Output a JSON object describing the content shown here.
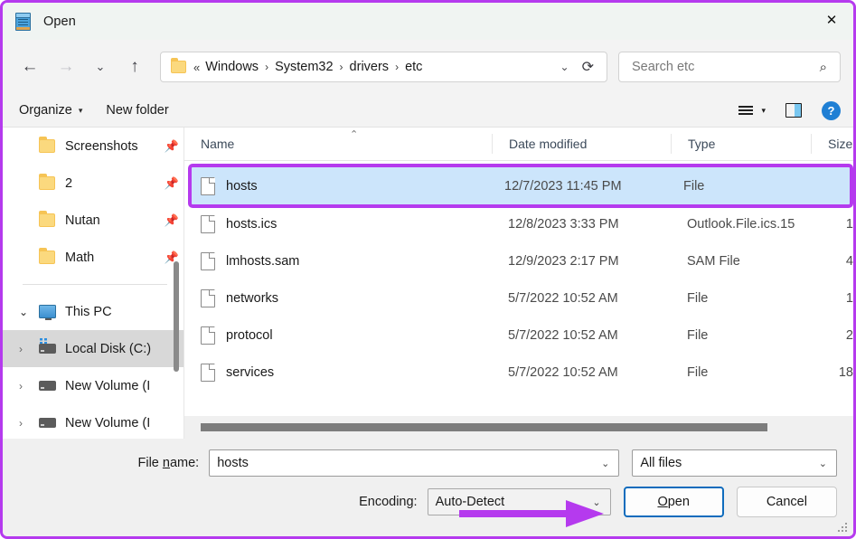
{
  "window": {
    "title": "Open",
    "icon": "notepad-icon",
    "close_label": "✕",
    "accent_annotation_color": "#b53aee",
    "focus_color": "#0f6cbd",
    "selection_color": "#cce5fb"
  },
  "nav": {
    "back": "←",
    "forward": "→",
    "recent": "⌄",
    "up": "↑",
    "breadcrumb": {
      "leading": "«",
      "items": [
        "Windows",
        "System32",
        "drivers",
        "etc"
      ],
      "separator": "›",
      "dropdown_caret": "⌄",
      "refresh": "⟳"
    },
    "search": {
      "placeholder": "Search etc",
      "icon": "⌕"
    }
  },
  "commandbar": {
    "organize": "Organize",
    "organize_caret": "▾",
    "new_folder": "New folder",
    "view_caret": "▾",
    "help": "?"
  },
  "sidebar": {
    "items": [
      {
        "label": "Screenshots",
        "icon": "folder-icon",
        "pin": "📌",
        "chevron": "",
        "selected": false,
        "type": "folder"
      },
      {
        "label": "2",
        "icon": "folder-icon",
        "pin": "📌",
        "chevron": "",
        "selected": false,
        "type": "folder"
      },
      {
        "label": "Nutan",
        "icon": "folder-icon",
        "pin": "📌",
        "chevron": "",
        "selected": false,
        "type": "folder"
      },
      {
        "label": "Math",
        "icon": "folder-icon",
        "pin": "📌",
        "chevron": "",
        "selected": false,
        "type": "folder"
      }
    ],
    "tree": [
      {
        "label": "This PC",
        "icon": "this-pc-icon",
        "chevron": "⌄",
        "selected": false,
        "type": "pc"
      },
      {
        "label": "Local Disk (C:)",
        "icon": "system-drive-icon",
        "chevron": "›",
        "selected": true,
        "type": "drive-sys"
      },
      {
        "label": "New Volume (I",
        "icon": "drive-icon",
        "chevron": "›",
        "selected": false,
        "type": "drive"
      },
      {
        "label": "New Volume (I",
        "icon": "drive-icon",
        "chevron": "›",
        "selected": false,
        "type": "drive"
      }
    ]
  },
  "filelist": {
    "sort_caret": "⌃",
    "columns": [
      "Name",
      "Date modified",
      "Type",
      "Size"
    ],
    "rows": [
      {
        "name": "hosts",
        "date": "12/7/2023 11:45 PM",
        "type": "File",
        "size": "",
        "selected": true
      },
      {
        "name": "hosts.ics",
        "date": "12/8/2023 3:33 PM",
        "type": "Outlook.File.ics.15",
        "size": "1",
        "selected": false
      },
      {
        "name": "lmhosts.sam",
        "date": "12/9/2023 2:17 PM",
        "type": "SAM File",
        "size": "4",
        "selected": false
      },
      {
        "name": "networks",
        "date": "5/7/2022 10:52 AM",
        "type": "File",
        "size": "1",
        "selected": false
      },
      {
        "name": "protocol",
        "date": "5/7/2022 10:52 AM",
        "type": "File",
        "size": "2",
        "selected": false
      },
      {
        "name": "services",
        "date": "5/7/2022 10:52 AM",
        "type": "File",
        "size": "18",
        "selected": false
      }
    ]
  },
  "footer": {
    "file_name_label_pre": "File ",
    "file_name_label_key": "n",
    "file_name_label_post": "ame:",
    "file_name_value": "hosts",
    "file_name_placeholder": "",
    "filter_value": "All files",
    "encoding_label": "Encoding:",
    "encoding_value": "Auto-Detect",
    "open_label_pre": "",
    "open_label_key": "O",
    "open_label_post": "pen",
    "cancel_label": "Cancel",
    "caret": "⌄"
  }
}
